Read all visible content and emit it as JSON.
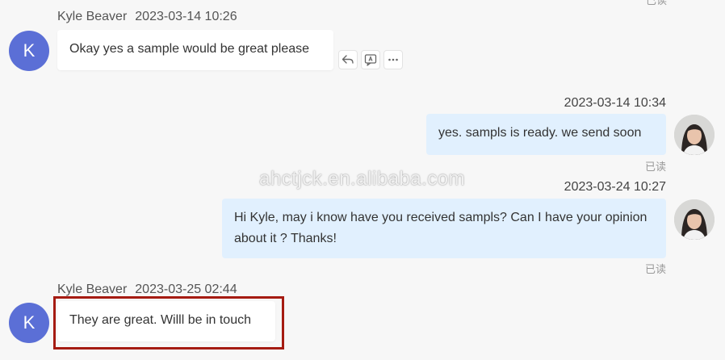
{
  "messages": [
    {
      "direction": "incoming",
      "sender": "Kyle Beaver",
      "time": "2023-03-14 10:26",
      "avatar_letter": "K",
      "text": "Okay yes a sample would be great please",
      "actions": [
        "reply-icon",
        "translate-icon",
        "more-icon"
      ]
    },
    {
      "direction": "outgoing",
      "time": "2023-03-14 10:34",
      "text": "yes. sampls is ready. we send soon",
      "status": "已读"
    },
    {
      "direction": "outgoing",
      "time": "2023-03-24 10:27",
      "text": "Hi Kyle, may i know have you received sampls? Can I have your opinion about it ? Thanks!",
      "status": "已读"
    },
    {
      "direction": "incoming",
      "sender": "Kyle Beaver",
      "time": "2023-03-25 02:44",
      "avatar_letter": "K",
      "text": "They are great. Willl be in touch",
      "highlighted": true
    }
  ],
  "watermark": "ahctjck.en.alibaba.com",
  "colors": {
    "avatar": "#5b6fd6",
    "outgoing_bubble": "#e1f0fe",
    "incoming_bubble": "#ffffff",
    "highlight_border": "#a51b12"
  }
}
